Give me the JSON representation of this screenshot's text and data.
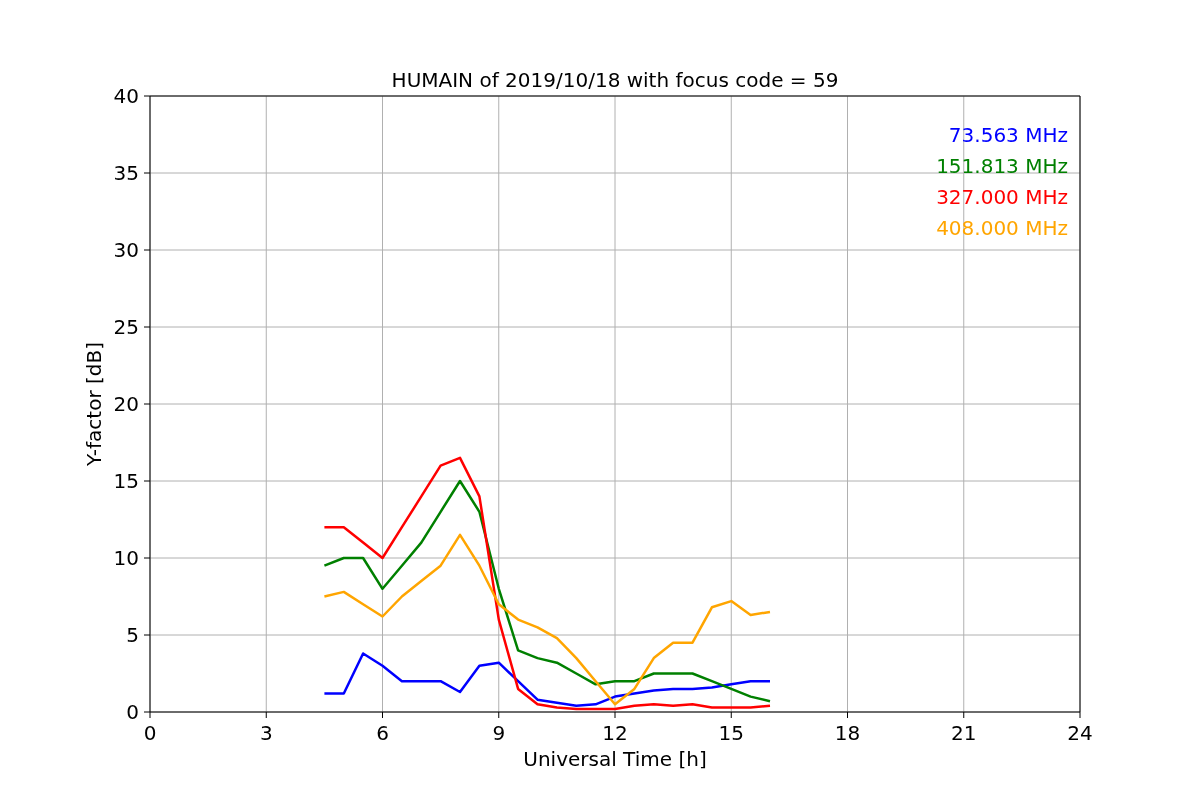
{
  "chart_data": {
    "type": "line",
    "title": "HUMAIN of 2019/10/18 with focus code = 59",
    "xlabel": "Universal Time [h]",
    "ylabel": "Y-factor [dB]",
    "x": [
      4.5,
      5,
      5.5,
      6,
      6.5,
      7,
      7.5,
      8,
      8.5,
      9,
      9.5,
      10,
      10.5,
      11,
      11.5,
      12,
      12.5,
      13,
      13.5,
      14,
      14.5,
      15,
      15.5,
      16
    ],
    "series": [
      {
        "name": "73.563 MHz",
        "color": "#0000ff",
        "values": [
          1.2,
          1.2,
          3.8,
          3,
          2,
          2,
          2,
          1.3,
          3,
          3.2,
          2,
          0.8,
          0.6,
          0.4,
          0.5,
          1,
          1.2,
          1.4,
          1.5,
          1.5,
          1.6,
          1.8,
          2,
          2
        ]
      },
      {
        "name": "151.813 MHz",
        "color": "#008000",
        "values": [
          9.5,
          10,
          10,
          8,
          9.5,
          11,
          13,
          15,
          13,
          8,
          4,
          3.5,
          3.2,
          2.5,
          1.8,
          2,
          2,
          2.5,
          2.5,
          2.5,
          2,
          1.5,
          1,
          0.7
        ]
      },
      {
        "name": "327.000 MHz",
        "color": "#ff0000",
        "values": [
          12,
          12,
          11,
          10,
          12,
          14,
          16,
          16.5,
          14,
          6,
          1.5,
          0.5,
          0.3,
          0.2,
          0.2,
          0.2,
          0.4,
          0.5,
          0.4,
          0.5,
          0.3,
          0.3,
          0.3,
          0.4
        ]
      },
      {
        "name": "408.000 MHz",
        "color": "#ffa500",
        "values": [
          7.5,
          7.8,
          7,
          6.2,
          7.5,
          8.5,
          9.5,
          11.5,
          9.5,
          7,
          6,
          5.5,
          4.8,
          3.5,
          2,
          0.5,
          1.5,
          3.5,
          4.5,
          4.5,
          6.8,
          7.2,
          6.3,
          6.5
        ]
      }
    ],
    "xlim": [
      0,
      24
    ],
    "ylim": [
      0,
      40
    ],
    "xticks": [
      0,
      3,
      6,
      9,
      12,
      15,
      18,
      21,
      24
    ],
    "yticks": [
      0,
      5,
      10,
      15,
      20,
      25,
      30,
      35,
      40
    ],
    "grid": true
  }
}
